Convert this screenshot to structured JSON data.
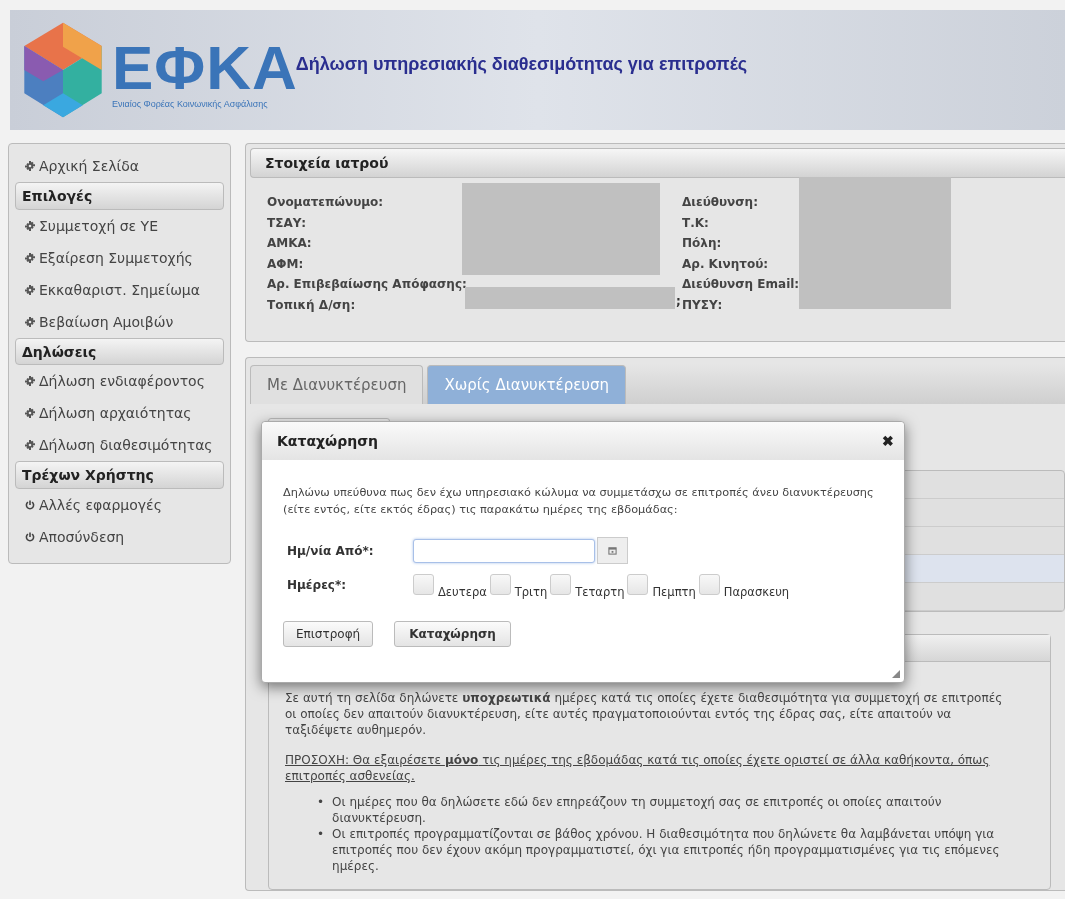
{
  "header": {
    "logo_text": "ΕΦΚΑ",
    "logo_subtitle": "Ενιαίος Φορέας Κοινωνικής Ασφάλισης",
    "title": "Δήλωση υπηρεσιακής διαθεσιμότητας για επιτροπές"
  },
  "sidebar": {
    "items": [
      {
        "kind": "gear-link",
        "label": "Αρχική Σελίδα"
      },
      {
        "kind": "section",
        "label": "Επιλογές"
      },
      {
        "kind": "gear-link",
        "label": "Συμμετοχή σε ΥΕ"
      },
      {
        "kind": "gear-link",
        "label": "Εξαίρεση Συμμετοχής"
      },
      {
        "kind": "gear-link",
        "label": "Εκκαθαριστ. Σημείωμα"
      },
      {
        "kind": "gear-link",
        "label": "Βεβαίωση Αμοιβών"
      },
      {
        "kind": "section",
        "label": "Δηλώσεις"
      },
      {
        "kind": "gear-link",
        "label": "Δήλωση ενδιαφέροντος"
      },
      {
        "kind": "gear-link",
        "label": "Δήλωση αρχαιότητας"
      },
      {
        "kind": "gear-link",
        "label": "Δήλωση διαθεσιμότητας"
      },
      {
        "kind": "section",
        "label": "Τρέχων Χρήστης"
      },
      {
        "kind": "power-link",
        "label": "Αλλές εφαρμογές"
      },
      {
        "kind": "power-link",
        "label": "Αποσύνδεση"
      }
    ]
  },
  "doctor": {
    "title": "Στοιχεία ιατρού",
    "left_fields": [
      {
        "label": "Ονοματεπώνυμο:"
      },
      {
        "label": "ΤΣΑΥ:"
      },
      {
        "label": "ΑΜΚΑ:"
      },
      {
        "label": "ΑΦΜ:"
      },
      {
        "label": "Αρ. Επιβεβαίωσης Απόφασης:"
      },
      {
        "label": "Τοπική Δ/ση:",
        "trailing": ";"
      }
    ],
    "right_fields": [
      {
        "label": "Διεύθυνση:"
      },
      {
        "label": "Τ.Κ:"
      },
      {
        "label": "Πόλη:"
      },
      {
        "label": "Αρ. Κινητού:"
      },
      {
        "label": "Διεύθυνση Email:"
      },
      {
        "label": "ΠΥΣΥ:"
      }
    ]
  },
  "tabs": [
    {
      "label": "Με Διανυκτέρευση",
      "selected": false
    },
    {
      "label": "Χωρίς Διανυκτέρευση",
      "selected": true
    }
  ],
  "info": {
    "paragraph": "Σε αυτή τη σελίδα δηλώνετε **υποχρεωτικά** ημέρες κατά τις οποίες έχετε διαθεσιμότητα για συμμετοχή σε επιτροπές οι οποίες δεν απαιτούν διανυκτέρευση, είτε αυτές πραγματοποιούνται εντός της έδρας σας, είτε απαιτούν να ταξιδέψετε αυθημερόν.",
    "warning": "ΠΡΟΣΟΧΗ: Θα εξαιρέσετε **μόνο** τις ημέρες της εβδομάδας κατά τις οποίες έχετε οριστεί σε άλλα καθήκοντα, όπως επιτροπές ασθενείας.",
    "bullets": [
      {
        "marker": "•",
        "text": "Οι ημέρες που θα δηλώσετε εδώ δεν επηρεάζουν τη συμμετοχή σας σε επιτροπές οι οποίες απαιτούν διανυκτέρευση."
      },
      {
        "marker": "•",
        "text": "Οι επιτροπές προγραμματίζονται σε βάθος χρόνου. Η διαθεσιμότητα που δηλώνετε θα λαμβάνεται υπόψη για επιτροπές που δεν έχουν ακόμη προγραμματιστεί, όχι για επιτροπές ήδη προγραμματισμένες για τις επόμενες ημέρες."
      }
    ]
  },
  "dialog": {
    "title": "Καταχώρηση",
    "close": "✖",
    "message": "Δηλώνω υπεύθυνα πως δεν έχω υπηρεσιακό κώλυμα να συμμετάσχω σε επιτροπές άνευ διανυκτέρευσης (είτε εντός, είτε εκτός έδρας) τις παρακάτω ημέρες της εβδομάδας:",
    "date_label": "Ημ/νία Από*:",
    "days_label": "Ημέρες*:",
    "days": [
      {
        "label": "Δευτερα",
        "checked": false
      },
      {
        "label": "Τριτη",
        "checked": false
      },
      {
        "label": "Τεταρτη",
        "checked": false
      },
      {
        "label": "Πεμπτη",
        "checked": false
      },
      {
        "label": "Παρασκευη",
        "checked": false
      }
    ],
    "buttons": [
      {
        "label": "Επιστροφή",
        "kind": "normal"
      },
      {
        "label": "Καταχώρηση",
        "kind": "primary"
      }
    ]
  }
}
